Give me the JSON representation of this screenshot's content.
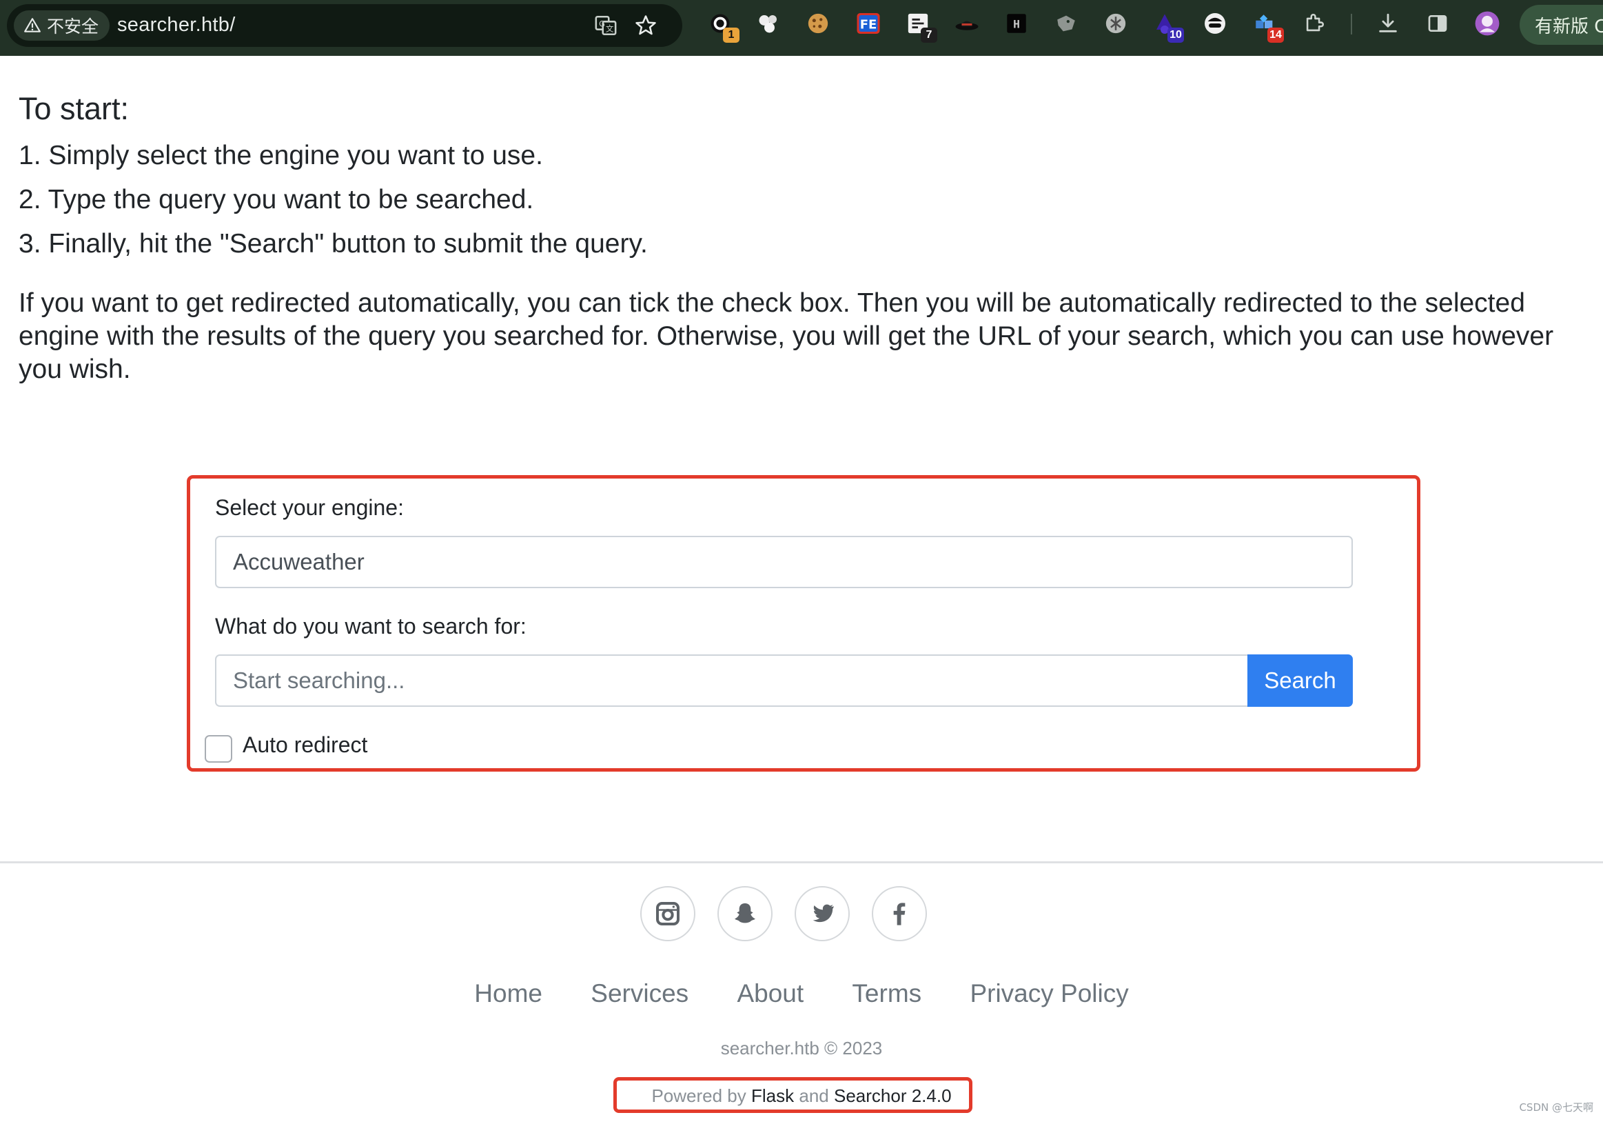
{
  "browser": {
    "security_label": "不安全",
    "url": "searcher.htb/",
    "update_label": "有新版 C",
    "extension_badges": {
      "ext1": "1",
      "ext5": "7",
      "ext10": "10",
      "ext12": "14"
    },
    "ext_fe_label": "FE",
    "ext_h_label": "H"
  },
  "intro": {
    "heading": "To start:",
    "steps": [
      "1. Simply select the engine you want to use.",
      "2. Type the query you want to be searched.",
      "3. Finally, hit the \"Search\" button to submit the query."
    ],
    "paragraph": "If you want to get redirected automatically, you can tick the check box. Then you will be automatically redirected to the selected engine with the results of the query you searched for. Otherwise, you will get the URL of your search, which you can use however you wish."
  },
  "form": {
    "engine_label": "Select your engine:",
    "engine_value": "Accuweather",
    "query_label": "What do you want to search for:",
    "query_placeholder": "Start searching...",
    "search_button": "Search",
    "auto_redirect_label": "Auto redirect",
    "auto_redirect_checked": false
  },
  "footer": {
    "social": [
      "instagram-icon",
      "snapchat-icon",
      "twitter-icon",
      "facebook-icon"
    ],
    "nav": [
      "Home",
      "Services",
      "About",
      "Terms",
      "Privacy Policy"
    ],
    "copyright": "searcher.htb © 2023",
    "powered_prefix": "Powered by",
    "powered_flask": "Flask",
    "powered_and": "and",
    "powered_searchor": "Searchor 2.4.0"
  },
  "watermark": "CSDN @七天啊",
  "colors": {
    "primary": "#2f7ff0",
    "highlight_frame": "#e33b2b",
    "chrome_bg": "#223226"
  }
}
